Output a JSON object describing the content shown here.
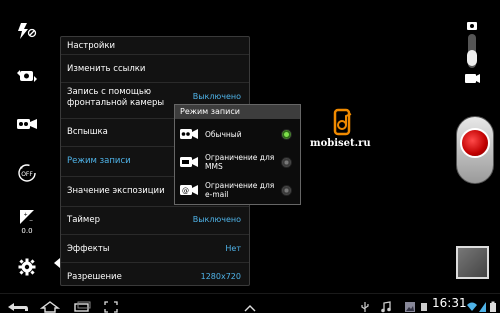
{
  "settings": {
    "title": "Настройки",
    "rows": [
      {
        "label": "Изменить ссылки",
        "value": ""
      },
      {
        "label": "Запись с помощью\nфронтальной камеры",
        "value": "Выключено"
      },
      {
        "label": "Вспышка",
        "value": ""
      },
      {
        "label": "Режим записи",
        "value": ""
      },
      {
        "label": "Значение экспозиции",
        "value": ""
      },
      {
        "label": "Таймер",
        "value": "Выключено"
      },
      {
        "label": "Эффекты",
        "value": "Нет"
      },
      {
        "label": "Разрешение",
        "value": "1280x720"
      }
    ]
  },
  "popup": {
    "title": "Режим записи",
    "options": [
      {
        "label": "Обычный",
        "selected": true
      },
      {
        "label": "Ограничение для\nMMS",
        "selected": false
      },
      {
        "label": "Ограничение для\ne-mail",
        "selected": false
      }
    ]
  },
  "left_toolbar": {
    "icons": [
      "flash-off-icon",
      "switch-camera-icon",
      "recording-mode-icon",
      "timer-off-icon",
      "exposure-icon",
      "settings-gear-icon"
    ],
    "exposure_value": "0.0",
    "timer_label": "OFF"
  },
  "watermark": {
    "text": "mobiset.ru"
  },
  "statusbar": {
    "time": "16:31"
  },
  "colors": {
    "accent": "#4fb3e8",
    "selected_radio": "#7de04a",
    "record": "#d00000"
  }
}
